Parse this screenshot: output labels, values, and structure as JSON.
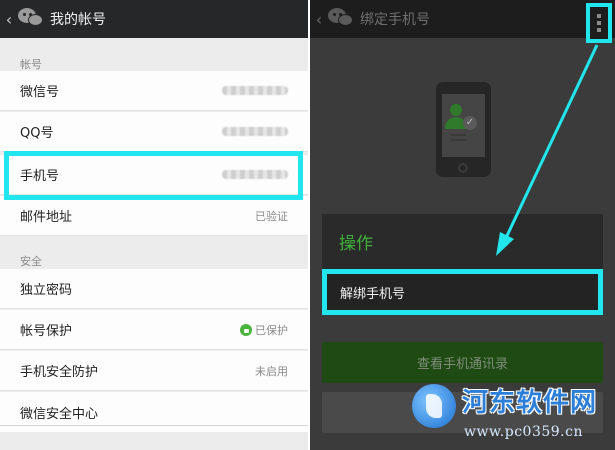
{
  "left": {
    "title": "我的帐号",
    "back_icon": "chevron-left-icon",
    "logo_icon": "wechat-logo-icon",
    "section_account": "帐号",
    "section_security": "安全",
    "rows": {
      "wechat_id": {
        "label": "微信号",
        "value": ""
      },
      "qq": {
        "label": "QQ号",
        "value": ""
      },
      "phone": {
        "label": "手机号",
        "value": ""
      },
      "email": {
        "label": "邮件地址",
        "value": "已验证"
      },
      "password": {
        "label": "独立密码"
      },
      "protection": {
        "label": "帐号保护",
        "value": "已保护"
      },
      "phone_security": {
        "label": "手机安全防护",
        "value": "未启用"
      },
      "security_center": {
        "label": "微信安全中心"
      }
    }
  },
  "right": {
    "title": "绑定手机号",
    "back_icon": "chevron-left-icon",
    "menu_icon": "more-vertical-icon",
    "dialog": {
      "title": "操作",
      "item": "解绑手机号"
    },
    "view_contacts_button": "查看手机通讯录"
  },
  "watermark": {
    "title": "河东软件网",
    "url": "www.pc0359.cn"
  },
  "colors": {
    "highlight": "#22e6ee",
    "wechat_green": "#3fb13a",
    "topbar": "#262728"
  }
}
